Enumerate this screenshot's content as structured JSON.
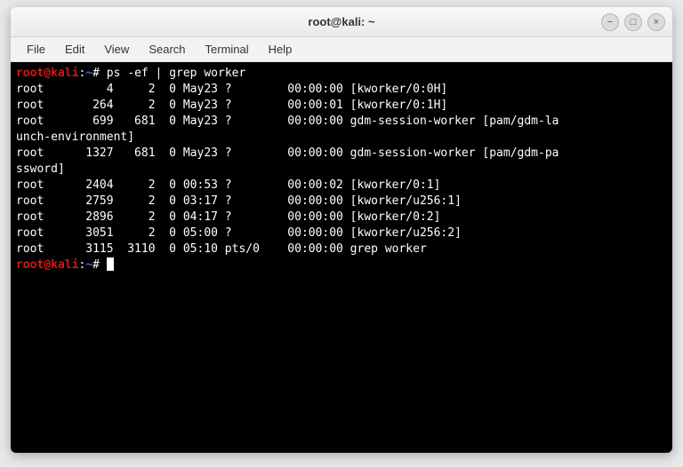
{
  "titlebar": {
    "title": "root@kali: ~"
  },
  "menubar": {
    "items": [
      "File",
      "Edit",
      "View",
      "Search",
      "Terminal",
      "Help"
    ]
  },
  "prompt": {
    "user_host": "root@kali",
    "colon": ":",
    "path": "~",
    "hash": "#"
  },
  "command1": " ps -ef | grep worker",
  "output": [
    "root         4     2  0 May23 ?        00:00:00 [kworker/0:0H]",
    "root       264     2  0 May23 ?        00:00:01 [kworker/0:1H]",
    "root       699   681  0 May23 ?        00:00:00 gdm-session-worker [pam/gdm-la",
    "unch-environment]",
    "root      1327   681  0 May23 ?        00:00:00 gdm-session-worker [pam/gdm-pa",
    "ssword]",
    "root      2404     2  0 00:53 ?        00:00:02 [kworker/0:1]",
    "root      2759     2  0 03:17 ?        00:00:00 [kworker/u256:1]",
    "root      2896     2  0 04:17 ?        00:00:00 [kworker/0:2]",
    "root      3051     2  0 05:00 ?        00:00:00 [kworker/u256:2]",
    "root      3115  3110  0 05:10 pts/0    00:00:00 grep worker"
  ],
  "command2": " "
}
